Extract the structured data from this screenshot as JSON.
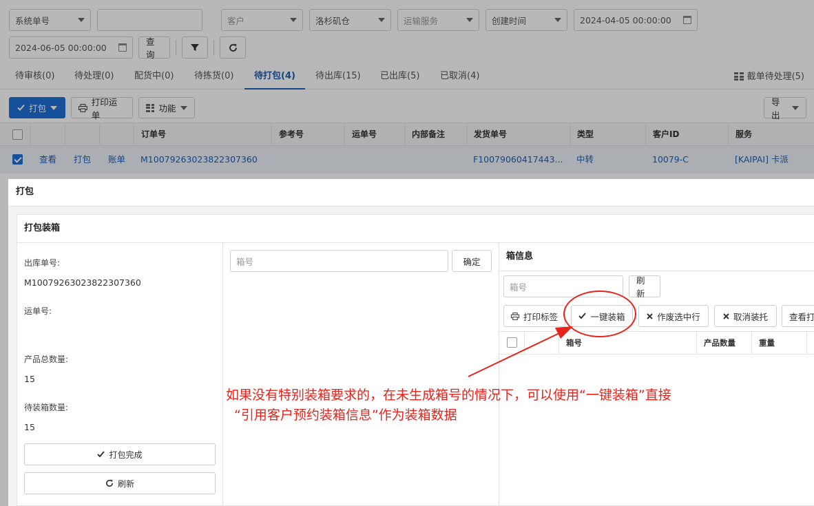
{
  "filters": {
    "order_type": "系统单号",
    "order_no_value": "",
    "customer_placeholder": "客户",
    "warehouse": "洛杉矶仓",
    "transport_placeholder": "运输服务",
    "time_type": "创建时间",
    "start_time": "2024-04-05 00:00:00",
    "end_time": "2024-06-05 00:00:00",
    "query_label": "查询"
  },
  "tabs": [
    {
      "label": "待审核(0)"
    },
    {
      "label": "待处理(0)"
    },
    {
      "label": "配货中(0)"
    },
    {
      "label": "待拣货(0)"
    },
    {
      "label": "待打包(4)"
    },
    {
      "label": "待出库(15)"
    },
    {
      "label": "已出库(5)"
    },
    {
      "label": "已取消(4)"
    }
  ],
  "tab_right": "截单待处理(5)",
  "toolbar": {
    "pack_label": "打包",
    "print_waybill_label": "打印运单",
    "function_label": "功能",
    "export_label": "导出"
  },
  "table": {
    "headers": [
      "订单号",
      "参考号",
      "运单号",
      "内部备注",
      "发货单号",
      "类型",
      "客户ID",
      "服务"
    ],
    "row": {
      "view": "查看",
      "pack": "打包",
      "bill": "账单",
      "order_no": "M10079263023822307360",
      "ref_no": "",
      "waybill": "",
      "remark": "",
      "ship_no": "F10079060417443...",
      "type": "中转",
      "customer_id": "10079-C",
      "service": "[KAIPAI] 卡派"
    }
  },
  "modal": {
    "title": "打包",
    "panel_title": "打包装箱",
    "outbound_label": "出库单号:",
    "outbound_value": "M10079263023822307360",
    "waybill_label": "运单号:",
    "waybill_value": "",
    "total_qty_label": "产品总数量:",
    "total_qty_value": "15",
    "pending_qty_label": "待装箱数量:",
    "pending_qty_value": "15",
    "finish_label": "打包完成",
    "refresh_label": "刷新",
    "box_input_placeholder": "箱号",
    "confirm_label": "确定",
    "box_info_title": "箱信息",
    "box_search_placeholder": "箱号",
    "box_refresh_label": "刷新",
    "print_label_btn": "打印标签",
    "one_click_btn": "一键装箱",
    "void_btn": "作废选中行",
    "cancel_pallet_btn": "取消装托",
    "view_print_btn": "查看打",
    "box_headers": [
      "箱号",
      "产品数量",
      "重量"
    ]
  },
  "annotation": {
    "line1": "如果没有特别装箱要求的，在未生成箱号的情况下，可以使用“一键装箱”直接",
    "line2": "“引用客户预约装箱信息”作为装箱数据"
  },
  "colors": {
    "primary": "#1f6fd6",
    "link": "#1b5fb8",
    "annotation": "#e8231b"
  }
}
